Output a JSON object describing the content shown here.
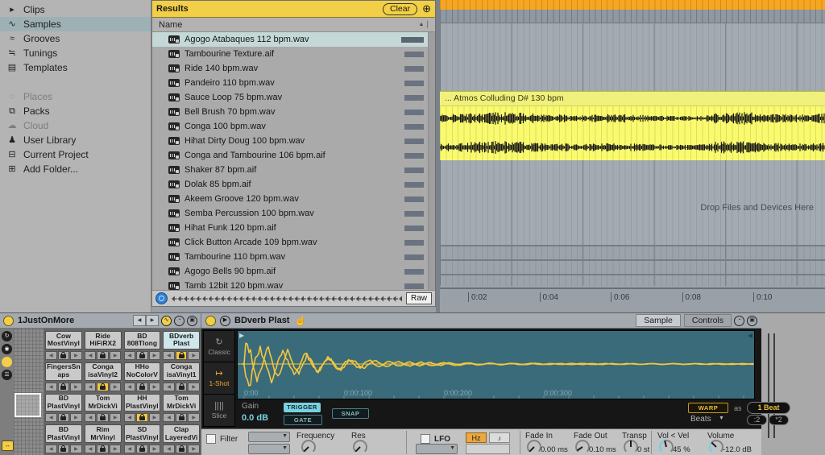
{
  "sidebar": {
    "groups": [
      {
        "items": [
          {
            "label": "Clips",
            "icon": "clip-icon",
            "glyph": "▸"
          },
          {
            "label": "Samples",
            "icon": "samples-icon",
            "glyph": "∿",
            "selected": true
          },
          {
            "label": "Grooves",
            "icon": "grooves-icon",
            "glyph": "≈"
          },
          {
            "label": "Tunings",
            "icon": "tunings-icon",
            "glyph": "≒"
          },
          {
            "label": "Templates",
            "icon": "templates-icon",
            "glyph": "▤"
          }
        ]
      },
      {
        "items": [
          {
            "label": "Places",
            "icon": "places-icon",
            "glyph": "◌",
            "dim": true
          },
          {
            "label": "Packs",
            "icon": "packs-icon",
            "glyph": "⧉"
          },
          {
            "label": "Cloud",
            "icon": "cloud-icon",
            "glyph": "☁",
            "dim": true
          },
          {
            "label": "User Library",
            "icon": "user-library-icon",
            "glyph": "♟"
          },
          {
            "label": "Current Project",
            "icon": "current-project-icon",
            "glyph": "⊟"
          },
          {
            "label": "Add Folder...",
            "icon": "add-folder-icon",
            "glyph": "⊞"
          }
        ]
      }
    ]
  },
  "results": {
    "title": "Results",
    "clear_label": "Clear",
    "add_icon": "⊕",
    "name_header": "Name",
    "sort_icon": "▲",
    "raw_label": "Raw",
    "items": [
      {
        "name": "Agogo Atabaques 112 bpm.wav",
        "selected": true
      },
      {
        "name": "Tambourine Texture.aif"
      },
      {
        "name": "Ride 140 bpm.wav"
      },
      {
        "name": "Pandeiro 110 bpm.wav"
      },
      {
        "name": "Sauce Loop 75 bpm.wav"
      },
      {
        "name": "Bell Brush 70 bpm.wav"
      },
      {
        "name": "Conga 100 bpm.wav"
      },
      {
        "name": "Hihat Dirty Doug 100 bpm.wav"
      },
      {
        "name": "Conga and Tambourine 106 bpm.aif"
      },
      {
        "name": "Shaker 87 bpm.aif"
      },
      {
        "name": "Dolak 85 bpm.aif"
      },
      {
        "name": "Akeem Groove 120 bpm.wav"
      },
      {
        "name": "Semba Percussion 100 bpm.wav"
      },
      {
        "name": "Hihat Funk 120 bpm.aif"
      },
      {
        "name": "Click Button Arcade 109 bpm.wav"
      },
      {
        "name": "Tambourine 110 bpm.wav"
      },
      {
        "name": "Agogo Bells 90 bpm.aif"
      },
      {
        "name": "Tamb 12bit 120 bpm.wav"
      }
    ]
  },
  "arrangement": {
    "clip_title": "... Atmos Colluding D# 130 bpm",
    "drop_hint": "Drop Files and Devices Here",
    "ruler_ticks": [
      "0:02",
      "0:04",
      "0:06",
      "0:08",
      "0:10"
    ]
  },
  "rack": {
    "track_title": "1JustOnMore",
    "pads": [
      {
        "line1": "Cow",
        "line2": "MostVinyl"
      },
      {
        "line1": "Ride",
        "line2": "HiFiRX2"
      },
      {
        "line1": "BD",
        "line2": "808Tlong"
      },
      {
        "line1": "BDverb",
        "line2": "Plast",
        "selected": true,
        "hotswap": true
      },
      {
        "line1": "FingersSn",
        "line2": "aps"
      },
      {
        "line1": "Conga",
        "line2": "isaVinyl2",
        "hotswap": true
      },
      {
        "line1": "HHo",
        "line2": "NoColorV"
      },
      {
        "line1": "Conga",
        "line2": "isaVinyl1"
      },
      {
        "line1": "BD",
        "line2": "PlastVinyl"
      },
      {
        "line1": "Tom",
        "line2": "MrDickVi"
      },
      {
        "line1": "HH",
        "line2": "PlastVinyl",
        "hotswap": true
      },
      {
        "line1": "Tom",
        "line2": "MrDickVi"
      },
      {
        "line1": "BD",
        "line2": "PlastVinyl"
      },
      {
        "line1": "Rim",
        "line2": "MrVinyl"
      },
      {
        "line1": "SD",
        "line2": "PlastVinyl"
      },
      {
        "line1": "Clap",
        "line2": "LayeredVi"
      }
    ]
  },
  "device": {
    "title": "BDverb Plast",
    "tabs": [
      {
        "label": "Sample",
        "selected": true
      },
      {
        "label": "Controls"
      }
    ],
    "modes": [
      {
        "label": "Classic",
        "glyph": "↻"
      },
      {
        "label": "1-Shot",
        "glyph": "↦",
        "selected": true
      },
      {
        "label": "Slice",
        "glyph": "||||"
      }
    ],
    "wave_times": [
      "0:00",
      "0:00:100",
      "0:00:200",
      "0:00:300"
    ],
    "gain_label": "Gain",
    "gain_value": "0.0 dB",
    "trigger_label": "TRIGGER",
    "gate_label": "GATE",
    "snap_label": "SNAP",
    "warp_label": "WARP",
    "as_label": "as",
    "warp_beat": "1 Beat",
    "warp_mode": "Beats",
    "half_label": ":2",
    "double_label": "*2",
    "filter": {
      "label": "Filter",
      "freq_label": "Frequency",
      "res_label": "Res"
    },
    "lfo": {
      "label": "LFO",
      "hz_label": "Hz",
      "note_glyph": "♪"
    },
    "knobs": [
      {
        "label": "Fade In",
        "value": "0.00 ms"
      },
      {
        "label": "Fade Out",
        "value": "0.10 ms"
      },
      {
        "label": "Transp",
        "value": "0 st"
      },
      {
        "label": "Vol < Vel",
        "value": "45 %"
      },
      {
        "label": "Volume",
        "value": "-12.0 dB"
      }
    ]
  },
  "colors": {
    "accent_yellow": "#f2cf46",
    "clip_yellow": "#fafa70",
    "wave_teal": "#3a6b7a",
    "wave_yellow": "#f4c63d",
    "cyan": "#79d1e0",
    "orange": "#f0a432",
    "pad_selected": "#cfe6ea"
  }
}
